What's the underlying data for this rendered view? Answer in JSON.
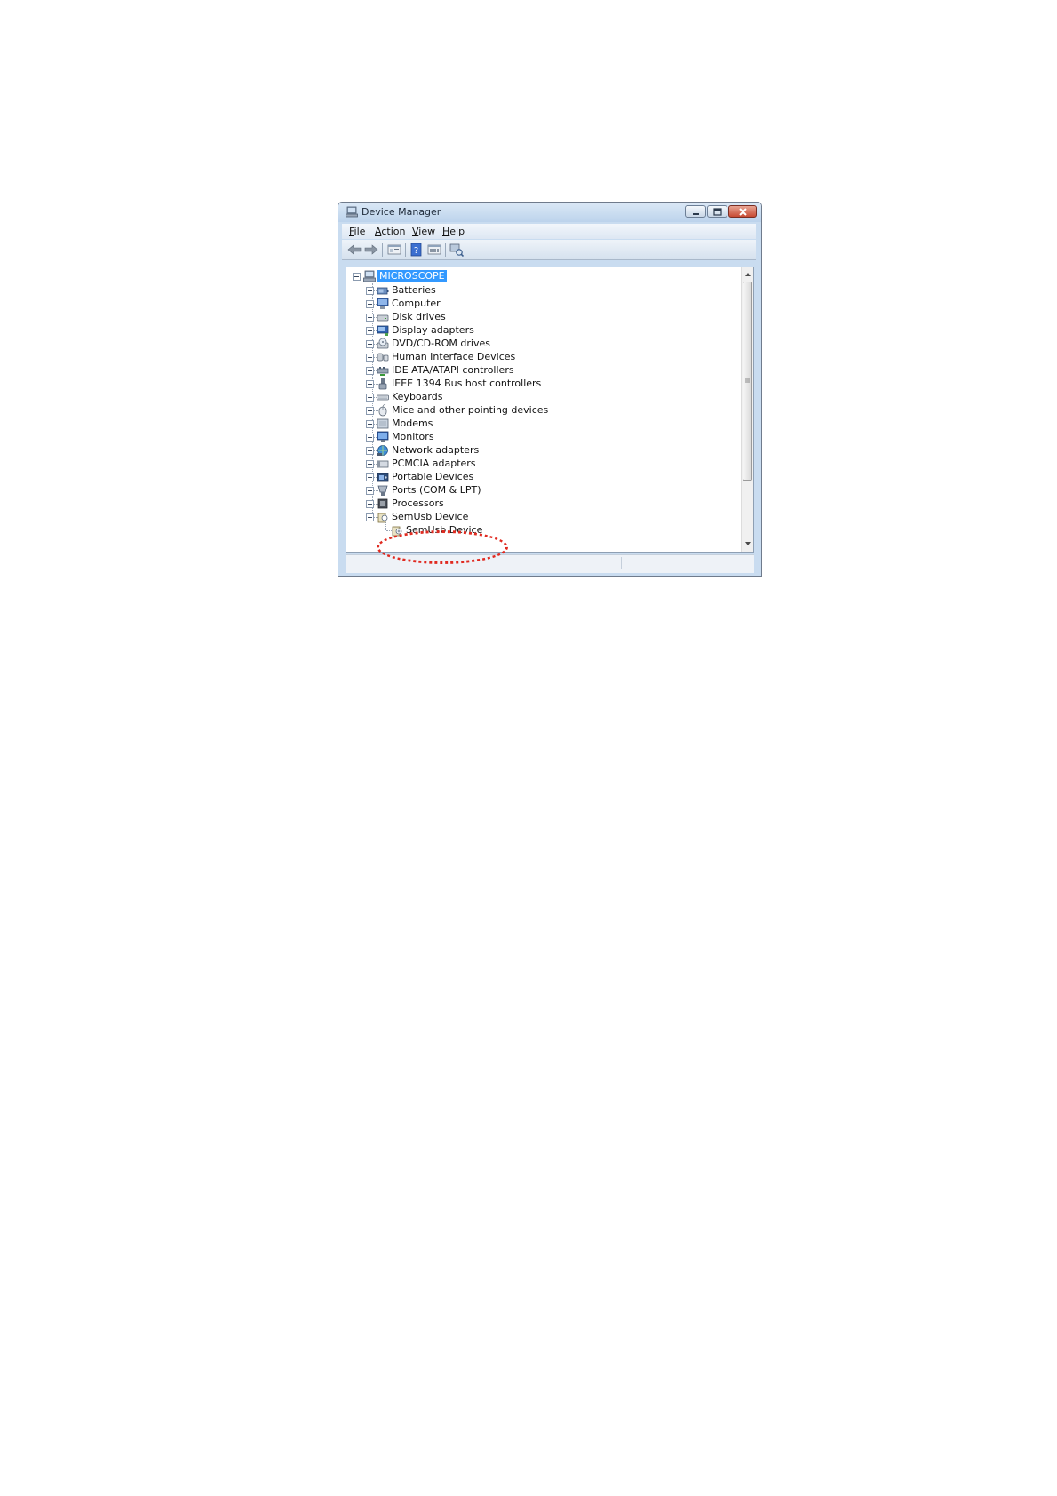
{
  "window": {
    "title": "Device Manager",
    "title_icon": "device-manager-icon"
  },
  "menu": {
    "items": [
      {
        "label": "File"
      },
      {
        "label": "Action"
      },
      {
        "label": "View"
      },
      {
        "label": "Help"
      }
    ]
  },
  "toolbar": {
    "buttons": [
      {
        "icon": "back-arrow-icon"
      },
      {
        "icon": "forward-arrow-icon"
      },
      {
        "icon": "properties-icon"
      },
      {
        "icon": "help-icon"
      },
      {
        "icon": "view-details-icon"
      },
      {
        "icon": "scan-hardware-icon"
      }
    ]
  },
  "tree": {
    "root": {
      "label": "MICROSCOPE",
      "selected": true
    },
    "categories": [
      {
        "label": "Batteries",
        "icon": "battery-icon"
      },
      {
        "label": "Computer",
        "icon": "computer-icon"
      },
      {
        "label": "Disk drives",
        "icon": "disk-drive-icon"
      },
      {
        "label": "Display adapters",
        "icon": "display-adapter-icon"
      },
      {
        "label": "DVD/CD-ROM drives",
        "icon": "dvd-drive-icon"
      },
      {
        "label": "Human Interface Devices",
        "icon": "hid-icon"
      },
      {
        "label": "IDE ATA/ATAPI controllers",
        "icon": "ide-controller-icon"
      },
      {
        "label": "IEEE 1394 Bus host controllers",
        "icon": "ieee1394-icon"
      },
      {
        "label": "Keyboards",
        "icon": "keyboard-icon"
      },
      {
        "label": "Mice and other pointing devices",
        "icon": "mouse-icon"
      },
      {
        "label": "Modems",
        "icon": "modem-icon"
      },
      {
        "label": "Monitors",
        "icon": "monitor-icon"
      },
      {
        "label": "Network adapters",
        "icon": "network-adapter-icon"
      },
      {
        "label": "PCMCIA adapters",
        "icon": "pcmcia-icon"
      },
      {
        "label": "Portable Devices",
        "icon": "portable-device-icon"
      },
      {
        "label": "Ports (COM & LPT)",
        "icon": "port-icon"
      },
      {
        "label": "Processors",
        "icon": "processor-icon"
      },
      {
        "label": "SemUsb Device",
        "icon": "usb-device-icon",
        "expanded": true
      }
    ],
    "child": {
      "label": "SemUsb Device",
      "icon": "usb-device-icon"
    }
  },
  "colors": {
    "selection": "#3399ff",
    "annotation": "#e02a20"
  }
}
